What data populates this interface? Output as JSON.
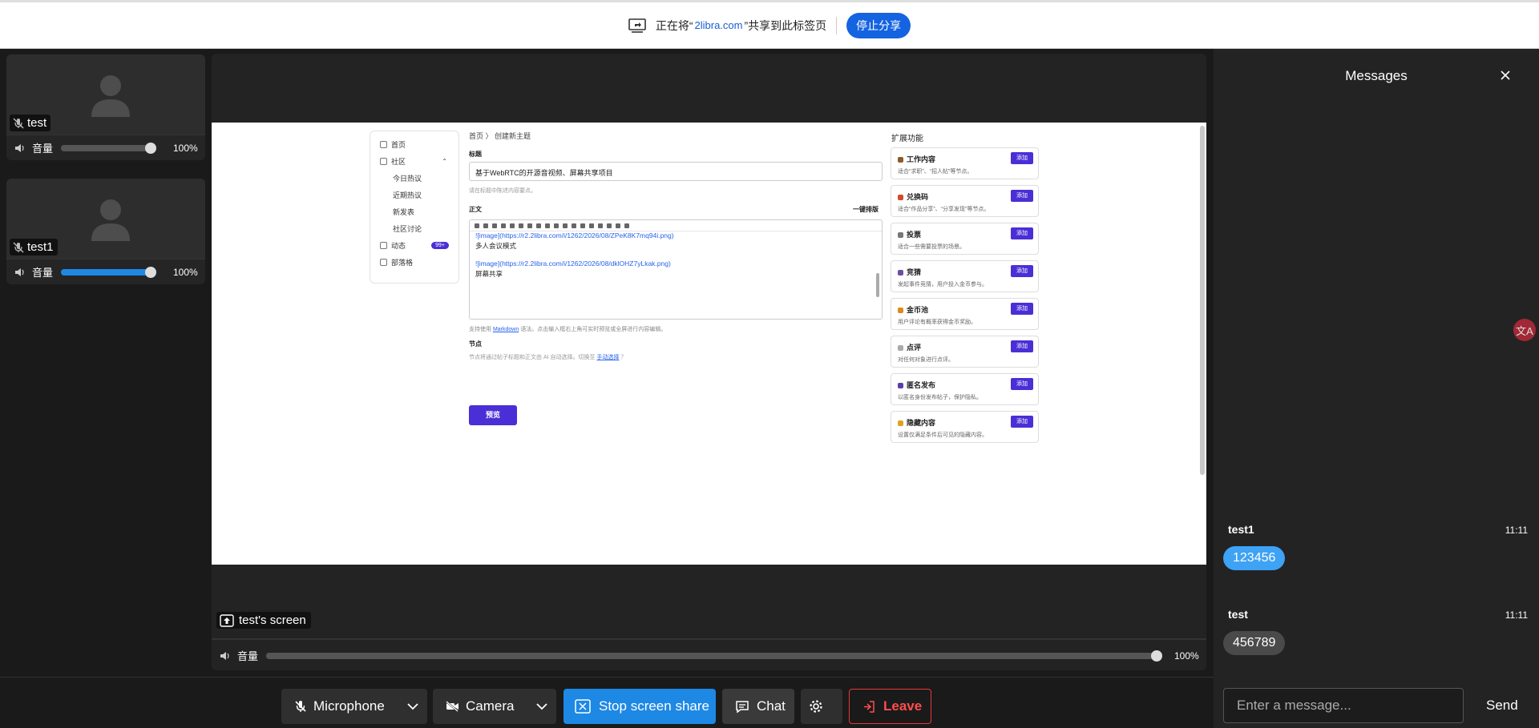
{
  "share_bar": {
    "prefix": "正在将“",
    "site": "2libra.com",
    "suffix": "”共享到此标签页",
    "stop_label": "停止分享"
  },
  "participants": [
    {
      "name": "test",
      "volume_label": "音量",
      "volume_pct": "100%",
      "volume_level": 1.0,
      "slider_active": false
    },
    {
      "name": "test1",
      "volume_label": "音量",
      "volume_pct": "100%",
      "volume_level": 1.0,
      "slider_active": true
    }
  ],
  "stage": {
    "screen_label": "test's screen",
    "volume_label": "音量",
    "volume_pct": "100%",
    "volume_level": 1.0
  },
  "shared_page": {
    "nav": {
      "home": "首页",
      "community": "社区",
      "today_hot": "今日热议",
      "recent_hot": "近期热议",
      "new_posts": "新发表",
      "discussion": "社区讨论",
      "dynamics": "动态",
      "dynamics_badge": "99+",
      "tribe": "部落格"
    },
    "breadcrumb": "首页 〉 创建新主题",
    "title_label": "标题",
    "title_value": "基于WebRTC的开源音视频、屏幕共享项目",
    "title_hint": "请在标题中陈述内容要点。",
    "body_label": "正文",
    "format_button": "一键排版",
    "editor_lines": [
      "![image](https://r2.2libra.com/i/1262/2026/08/ZPeK8K7mq94i.png)",
      "多人会议模式",
      "![image](https://r2.2libra.com/i/1262/2026/08/dklOHZ7yLkak.png)",
      "屏幕共享"
    ],
    "md_hint_prefix": "支持使用",
    "md_hint_link": "Markdown",
    "md_hint_suffix": "语法。点击输入框右上角可实时预览或全屏进行内容编辑。",
    "node_label": "节点",
    "node_hint_prefix": "节点将通过帖子标题和正文由 AI 自动选择。切换至",
    "node_hint_link": "手动选择",
    "node_hint_suffix": "？",
    "preview_button": "预览",
    "ext_title": "扩展功能",
    "ext_cards": [
      {
        "name": "工作内容",
        "desc": "适合“求职”、“招人帖”等节点。",
        "add": "添加",
        "color": "#8b5a2b"
      },
      {
        "name": "兑换码",
        "desc": "适合“作品分享”、“分享发现”等节点。",
        "add": "添加",
        "color": "#d4492a"
      },
      {
        "name": "投票",
        "desc": "适合一些需要投票的场景。",
        "add": "添加",
        "color": "#777777"
      },
      {
        "name": "竞猜",
        "desc": "发起事件竞猜，用户投入金币参与。",
        "add": "添加",
        "color": "#6a4fa0"
      },
      {
        "name": "金币池",
        "desc": "用户评论有概率获得金币奖励。",
        "add": "添加",
        "color": "#e08a1e"
      },
      {
        "name": "点评",
        "desc": "对任何对象进行点评。",
        "add": "添加",
        "color": "#aaaaaa"
      },
      {
        "name": "匿名发布",
        "desc": "以匿名身份发布帖子，保护隐私。",
        "add": "添加",
        "color": "#5b3fa8"
      },
      {
        "name": "隐藏内容",
        "desc": "设置仅满足条件后可见的隐藏内容。",
        "add": "添加",
        "color": "#e0a11e"
      }
    ]
  },
  "chat": {
    "title": "Messages",
    "messages": [
      {
        "author": "test1",
        "time": "11:11",
        "text": "123456",
        "color": "#3ea2f5"
      },
      {
        "author": "test",
        "time": "11:11",
        "text": "456789",
        "color": "#4a4a4a"
      }
    ],
    "translate_glyph": "文A",
    "input_placeholder": "Enter a message...",
    "send_label": "Send"
  },
  "toolbar": {
    "microphone": "Microphone",
    "camera": "Camera",
    "stop_share": "Stop screen share",
    "chat": "Chat",
    "leave": "Leave",
    "colors": {
      "share": "#1e88e5",
      "leave_border": "#e53935",
      "leave_text": "#ff4d4d"
    }
  }
}
